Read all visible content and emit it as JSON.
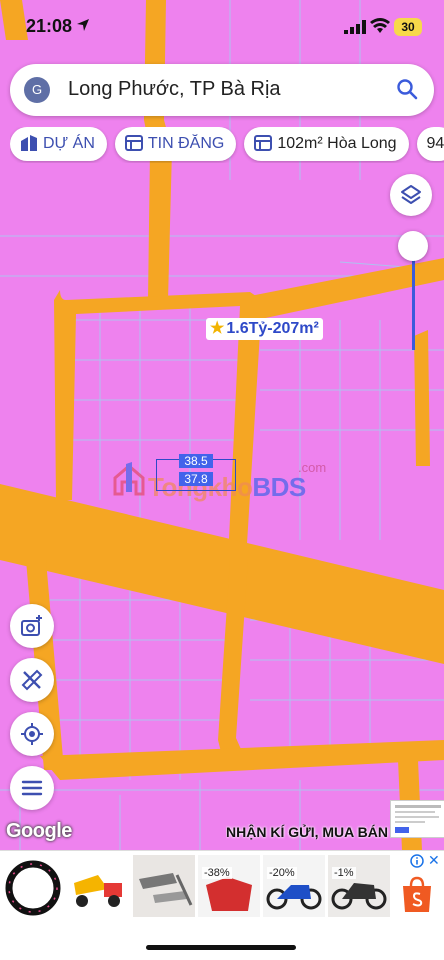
{
  "status_bar": {
    "time": "21:08",
    "battery": "30"
  },
  "search": {
    "avatar_letter": "G",
    "query": "Long Phước, TP Bà Rịa"
  },
  "chips": [
    {
      "label": "DỰ ÁN",
      "icon": "building-icon"
    },
    {
      "label": "TIN ĐĂNG",
      "icon": "calendar-icon"
    },
    {
      "label": "102m² Hòa Long",
      "icon": "calendar-icon"
    },
    {
      "label": "94"
    }
  ],
  "map": {
    "price_label": "1.6Tỷ-207m²",
    "dim_top": "38.5",
    "dim_bottom": "37.8",
    "watermark_brand": "TongkhoBDS",
    "watermark_part1": "Tongkho",
    "watermark_part2": "BDS",
    "watermark_suffix": ".com",
    "google_logo": "Google",
    "marquee_text": "NHẬN KÍ GỬI, MUA BÁN",
    "colors": {
      "land": "#ee82ee",
      "road": "#f5a623",
      "parcel_line": "#a8c8f0"
    }
  },
  "side_buttons": [
    {
      "name": "camera-plus-button",
      "icon": "camera-plus-icon"
    },
    {
      "name": "measure-tool-button",
      "icon": "ruler-pencil-icon"
    },
    {
      "name": "my-location-button",
      "icon": "crosshair-icon"
    },
    {
      "name": "menu-button",
      "icon": "hamburger-icon"
    }
  ],
  "ad": {
    "products": [
      {
        "name": "ring-light",
        "badge": ""
      },
      {
        "name": "toy-dump-truck",
        "badge": ""
      },
      {
        "name": "exhaust-pipes",
        "badge": ""
      },
      {
        "name": "red-motor-part",
        "badge": "-38%"
      },
      {
        "name": "motorbike-blue",
        "badge": "-20%"
      },
      {
        "name": "motorbike-black",
        "badge": "-1%"
      }
    ],
    "shop_icon": "shopee-bag-icon"
  }
}
